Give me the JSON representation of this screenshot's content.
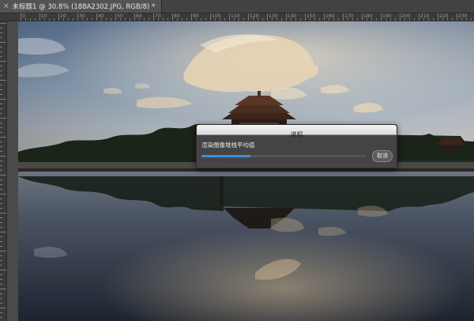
{
  "document_tab": {
    "title": "未标题1 @ 30.8% (188A2302.JPG, RGB/8) *",
    "close_glyph": "×"
  },
  "ruler": {
    "top_labels": [
      "0",
      "10",
      "20",
      "30",
      "40",
      "50",
      "60",
      "70",
      "80",
      "90",
      "100",
      "110",
      "120",
      "130",
      "140",
      "150",
      "160",
      "170",
      "180",
      "190",
      "200",
      "210",
      "220",
      "230"
    ]
  },
  "canvas": {
    "image_name": "188A2302.JPG",
    "zoom": "30.8%",
    "mode": "RGB/8"
  },
  "progress_dialog": {
    "title": "进程",
    "message": "渲染图像堆栈平均值",
    "progress": 0.3,
    "cancel_label": "取消",
    "accent_color": "#3a8ee6"
  }
}
